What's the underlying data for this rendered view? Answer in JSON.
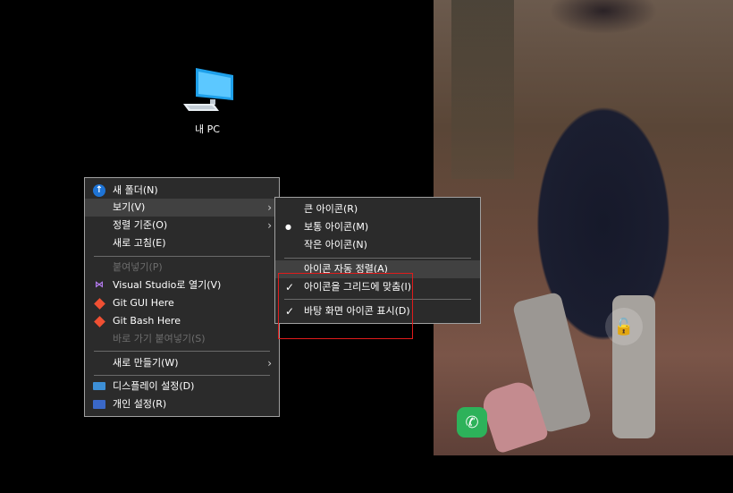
{
  "desktop": {
    "icons": [
      {
        "label": "내 PC",
        "icon": "computer-icon"
      }
    ]
  },
  "context_menu": {
    "items": [
      {
        "label": "새 폴더(N)",
        "icon": "new-folder-icon"
      },
      {
        "label": "보기(V)",
        "has_submenu": true
      },
      {
        "label": "정렬 기준(O)",
        "has_submenu": true
      },
      {
        "label": "새로 고침(E)"
      },
      {
        "label": "붙여넣기(P)",
        "disabled": true
      },
      {
        "label": "Visual Studio로 열기(V)",
        "icon": "visual-studio-icon"
      },
      {
        "label": "Git GUI Here",
        "icon": "git-icon"
      },
      {
        "label": "Git Bash Here",
        "icon": "git-icon"
      },
      {
        "label": "바로 가기 붙여넣기(S)",
        "disabled": true
      },
      {
        "label": "새로 만들기(W)",
        "has_submenu": true
      },
      {
        "label": "디스플레이 설정(D)",
        "icon": "display-icon"
      },
      {
        "label": "개인 설정(R)",
        "icon": "personalize-icon"
      }
    ],
    "submenu_arrow": "›"
  },
  "view_submenu": {
    "items": [
      {
        "label": "큰 아이콘(R)"
      },
      {
        "label": "보통 아이콘(M)",
        "selected": true
      },
      {
        "label": "작은 아이콘(N)"
      },
      {
        "label": "아이콘 자동 정렬(A)"
      },
      {
        "label": "아이콘을 그리드에 맞춤(I)",
        "checked": true
      },
      {
        "label": "바탕 화면 아이콘 표시(D)",
        "checked": true
      }
    ],
    "bullet": "●",
    "check": "✓"
  },
  "wallpaper": {
    "lock_icon": "unlock-icon",
    "call_icon": "phone-icon"
  },
  "colors": {
    "menu_bg": "#2b2b2b",
    "menu_border": "#a0a0a0",
    "highlight": "#414141",
    "disabled_text": "#6d6d6d",
    "annotation_box": "#e01b1b"
  }
}
